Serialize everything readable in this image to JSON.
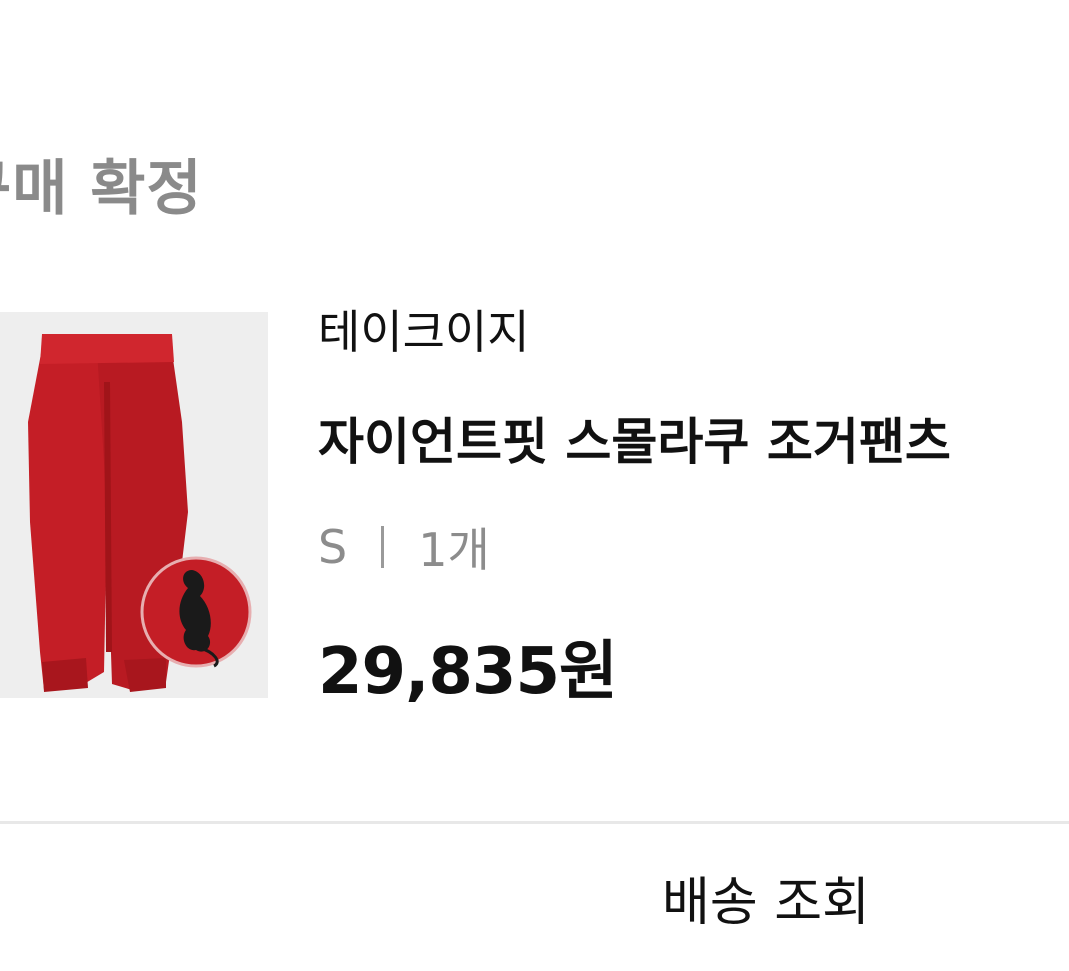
{
  "order": {
    "status_title": "구매 확정"
  },
  "product": {
    "brand": "테이크이지",
    "name": "자이언트핏 스몰라쿠 조거팬츠",
    "option_size": "S",
    "option_quantity": "1개",
    "price": "29,835원",
    "image_icon": "red-jogger-pants-thumbnail"
  },
  "actions": {
    "delivery_tracking_label": "배송 조회"
  },
  "colors": {
    "pants": "#c41e26",
    "thumb_background": "#eeeeee",
    "status_text": "#8a8a8a"
  }
}
